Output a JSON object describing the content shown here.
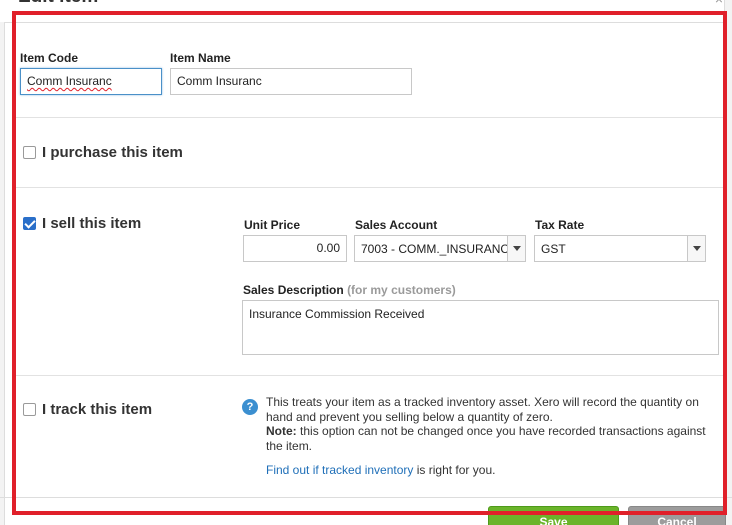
{
  "dialog": {
    "title": "Edit item",
    "close_symbol": "×"
  },
  "item": {
    "code_label": "Item Code",
    "code_value": "Comm Insuranc",
    "name_label": "Item Name",
    "name_value": "Comm Insuranc"
  },
  "purchase": {
    "label": "I purchase this item",
    "checked": false
  },
  "sell": {
    "label": "I sell this item",
    "checked": true,
    "unit_price_label": "Unit Price",
    "unit_price_value": "0.00",
    "sales_account_label": "Sales Account",
    "sales_account_value": "7003 - COMM._INSURANC",
    "tax_rate_label": "Tax Rate",
    "tax_rate_value": "GST",
    "description_label": "Sales Description",
    "description_hint": "(for my customers)",
    "description_value": "Insurance Commission Received"
  },
  "track": {
    "label": "I track this item",
    "checked": false,
    "info_icon": "?",
    "info_line": "This treats your item as a tracked inventory asset. Xero will record the quantity on hand and prevent you selling below a quantity of zero.",
    "note_label": "Note:",
    "note_text": "this option can not be changed once you have recorded transactions against the item.",
    "link_text": "Find out if tracked inventory",
    "link_suffix": "is right for you."
  },
  "buttons": {
    "save": "Save",
    "cancel": "Cancel"
  },
  "colors": {
    "highlight_frame": "#e0202a",
    "save": "#6ab42a",
    "link": "#1f6fb8",
    "checkbox": "#2a6fc9"
  }
}
